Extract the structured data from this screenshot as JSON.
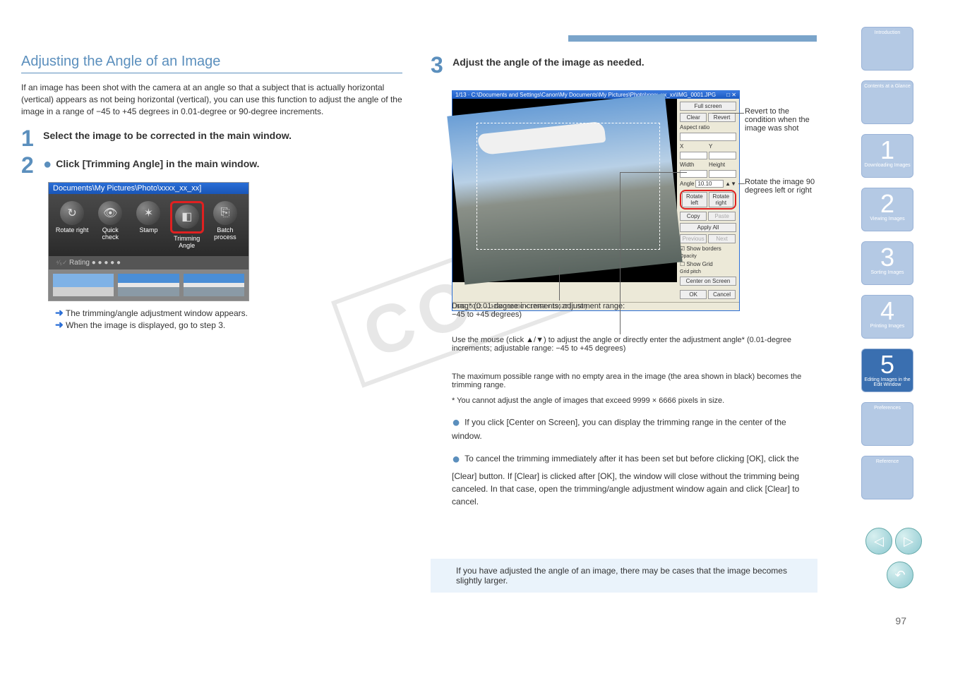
{
  "accent": "#7aa4ca",
  "title": "Adjusting the Angle of an Image",
  "intro": "If an image has been shot with the camera at an angle so that a subject that is actually horizontal (vertical) appears as not being horizontal (vertical), you can use this function to adjust the angle of the image in a range of −45 to +45 degrees in 0.01-degree or 90-degree increments.",
  "step1": "Select the image to be corrected in the main window.",
  "step2_a": "Click [Trimming Angle] in the main window.",
  "toolbar_titlebar": "Documents\\My Pictures\\Photo\\xxxx_xx_xx]",
  "toolbar": {
    "rotate": "Rotate right",
    "quick": "Quick check",
    "stamp": "Stamp",
    "trim": "Trimming Angle",
    "batch": "Batch process",
    "rating": "Rating  ● ● ● ● ●"
  },
  "result1": "The trimming/angle adjustment window appears.",
  "result2": "When the image is displayed, go to step 3.",
  "step3": "Adjust the angle of the image as needed.",
  "editor_titlebar": "1/13 · C:\\Documents and Settings\\Canon\\My Documents\\My Pictures\\Photo\\xxxx_xx_xx\\IMG_0001.JPG",
  "panel": {
    "fullscreen": "Full screen",
    "clear": "Clear",
    "revert": "Revert",
    "aspect": "Aspect ratio",
    "x": "X",
    "y": "Y",
    "width": "Width",
    "height": "Height",
    "angle": "Angle",
    "angle_val": "10.10",
    "rotl": "Rotate left",
    "rotr": "Rotate right",
    "copy": "Copy",
    "paste": "Paste",
    "apply_all": "Apply All",
    "previous": "Previous",
    "next": "Next",
    "showborders": "Show borders",
    "opacity": "Opacity",
    "showgrid": "Show Grid",
    "gridpitch": "Grid pitch",
    "centeron": "Center on Screen",
    "ok": "OK",
    "cancel": "Cancel"
  },
  "statusbar": "IMG_0012 → 12240 16830 × 17659 × 12627 [ 1.50 ]",
  "callouts": {
    "revert": "Revert to the condition when the image was shot",
    "rot90": "Rotate the image 90 degrees left or right",
    "draghere": "Drag* (0.01-degree increments; adjustment range: −45 to +45 degrees)",
    "mouseclick": "Use the mouse (click ▲/▼) to adjust the angle or directly enter the adjustment angle* (0.01-degree increments; adjustable range: −45 to +45 degrees)",
    "maxrange": "The maximum possible range with no empty area in the image (the area shown in black) becomes the trimming range.",
    "note": "* You cannot adjust the angle of images that exceed 9999 × 6666 pixels in size."
  },
  "bullets": {
    "centeron": "If you click [Center on Screen], you can display the trimming range in the center of the window.",
    "cancel": "To cancel the trimming immediately after it has been set but before clicking [OK], click the [Clear] button. If [Clear] is clicked after [OK], the window will close without the trimming being canceled. In that case, open the trimming/angle adjustment window again and click [Clear] to cancel."
  },
  "tip": "If you have adjusted the angle of an image, there may be cases that the image becomes slightly larger.",
  "nav": {
    "intro": "Introduction",
    "contents": "Contents at a Glance",
    "c1": "Downloading Images",
    "c2": "Viewing Images",
    "c3": "Sorting Images",
    "c4": "Printing Images",
    "c5": "Editing Images in the Edit Window",
    "pref": "Preferences",
    "ref": "Reference"
  },
  "pageno": "97"
}
